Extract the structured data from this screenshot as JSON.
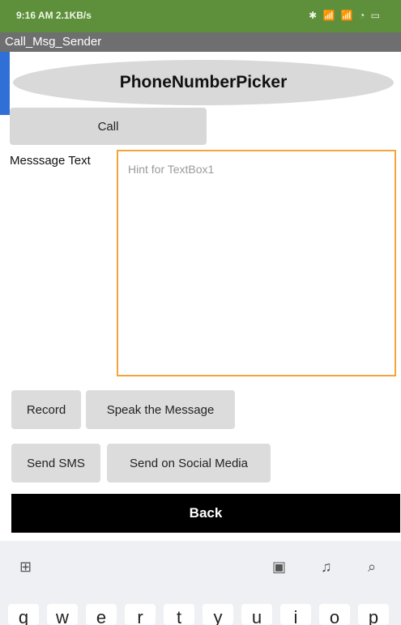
{
  "status_bar": {
    "time": "9:16 AM 2.1KB/s",
    "right_icons": "✱ 📶 📶 ◔ ▭"
  },
  "app": {
    "title": "Call_Msg_Sender"
  },
  "picker": {
    "label": "PhoneNumberPicker"
  },
  "call": {
    "label": "Call"
  },
  "message": {
    "label": "Messsage Text",
    "placeholder": "Hint for TextBox1"
  },
  "buttons": {
    "record": "Record",
    "speak": "Speak the Message",
    "send_sms": "Send SMS",
    "send_social": "Send on Social Media",
    "back": "Back"
  },
  "keyboard": {
    "toolbar_icons": [
      "grid-icon",
      "clipboard-icon",
      "mic-icon",
      "search-icon"
    ],
    "keys": [
      "q",
      "w",
      "e",
      "r",
      "t",
      "y",
      "u",
      "i",
      "o",
      "p"
    ]
  },
  "colors": {
    "accent_border": "#f4a43b",
    "statusbar": "#5e8f3b"
  }
}
